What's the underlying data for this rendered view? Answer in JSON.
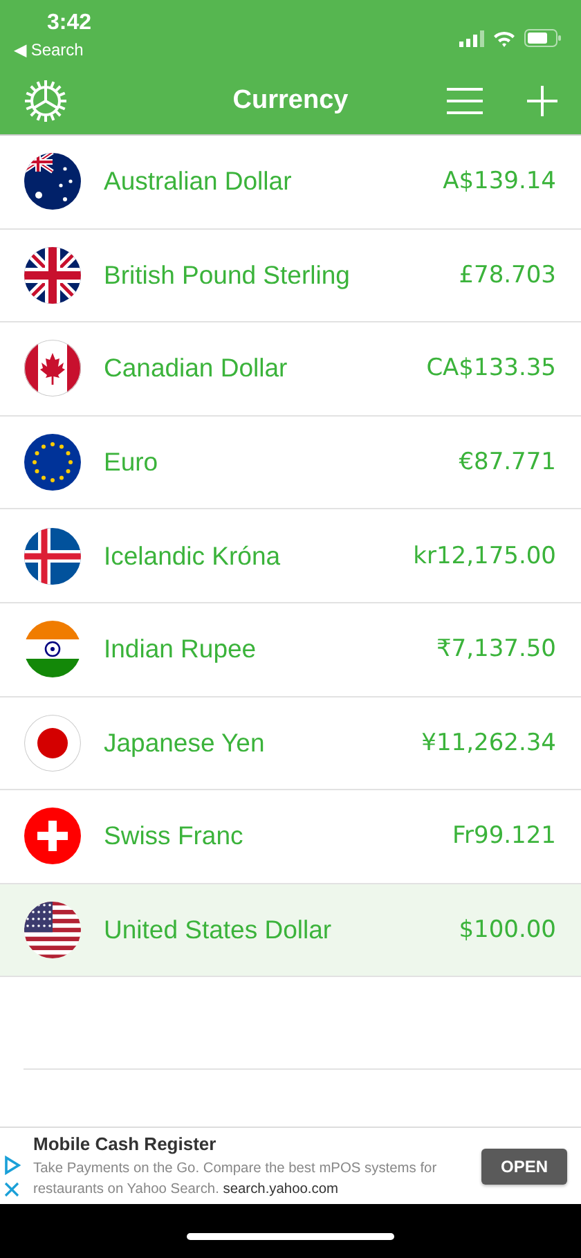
{
  "status_bar": {
    "time": "3:42",
    "back_label": "◀ Search"
  },
  "nav_bar": {
    "title": "Currency"
  },
  "currencies": [
    {
      "kind": "au",
      "name": "Australian Dollar",
      "amount": "A$139.14",
      "selected": false
    },
    {
      "kind": "gb",
      "name": "British Pound Sterling",
      "amount": "£78.703",
      "selected": false
    },
    {
      "kind": "ca",
      "name": "Canadian Dollar",
      "amount": "CA$133.35",
      "selected": false
    },
    {
      "kind": "eu",
      "name": "Euro",
      "amount": "€87.771",
      "selected": false
    },
    {
      "kind": "is",
      "name": "Icelandic Króna",
      "amount": "kr12,175.00",
      "selected": false
    },
    {
      "kind": "in",
      "name": "Indian Rupee",
      "amount": "₹7,137.50",
      "selected": false
    },
    {
      "kind": "jp",
      "name": "Japanese Yen",
      "amount": "¥11,262.34",
      "selected": false
    },
    {
      "kind": "ch",
      "name": "Swiss Franc",
      "amount": "Fr99.121",
      "selected": false
    },
    {
      "kind": "us",
      "name": "United States Dollar",
      "amount": "$100.00",
      "selected": true
    }
  ],
  "ad": {
    "title": "Mobile Cash Register",
    "body": "Take Payments on the Go. Compare the best mPOS systems for restaurants on Yahoo Search.",
    "link": "search.yahoo.com",
    "button": "OPEN"
  }
}
